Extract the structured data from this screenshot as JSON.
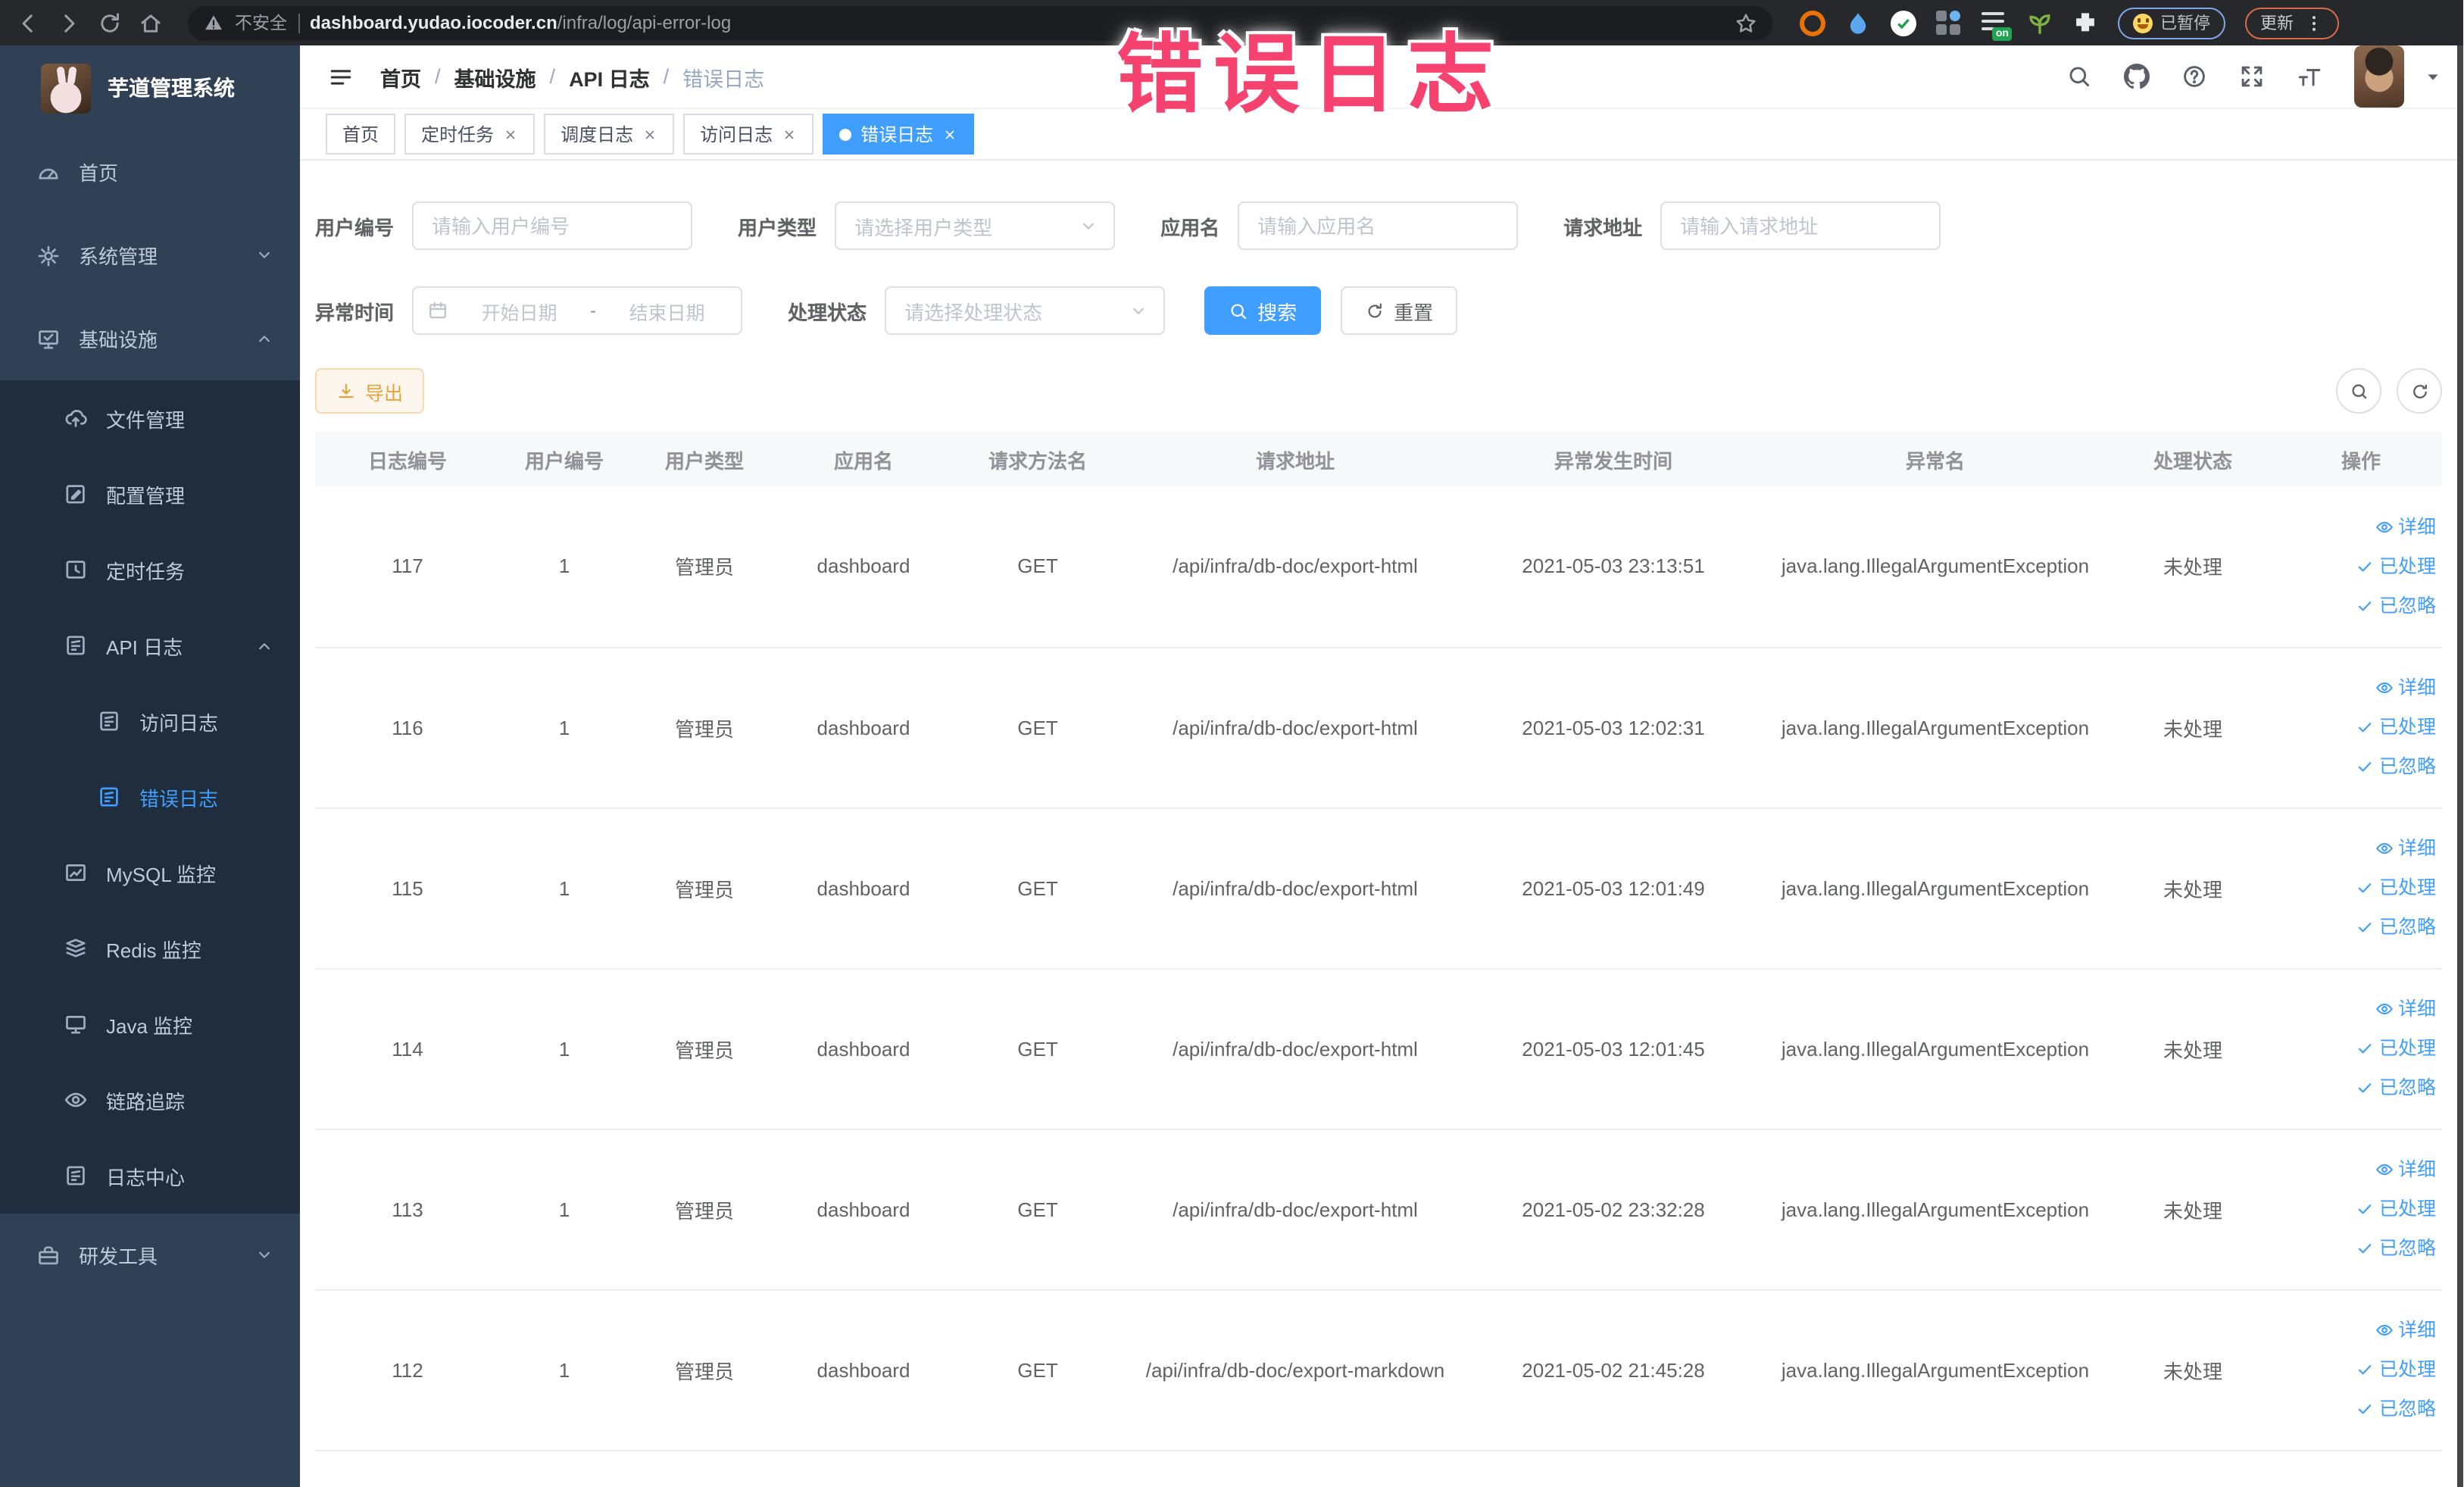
{
  "browser": {
    "security_label": "不安全",
    "url_host": "dashboard.yudao.iocoder.cn",
    "url_path": "/infra/log/api-error-log",
    "paused_label": "已暂停",
    "update_label": "更新",
    "on_badge": "on"
  },
  "annotation": {
    "text": "错误日志",
    "color": "#f5426f"
  },
  "sidebar": {
    "title": "芋道管理系统",
    "menu": [
      {
        "name": "home",
        "label": "首页",
        "icon": "dashboard-icon",
        "level": 1,
        "sub": false,
        "chevron": "",
        "active": false
      },
      {
        "name": "system",
        "label": "系统管理",
        "icon": "gear-icon",
        "level": 1,
        "sub": false,
        "chevron": "down",
        "active": false
      },
      {
        "name": "infra",
        "label": "基础设施",
        "icon": "monitor-check-icon",
        "level": 1,
        "sub": false,
        "chevron": "up",
        "active": false
      },
      {
        "name": "file",
        "label": "文件管理",
        "icon": "cloud-upload-icon",
        "level": 2,
        "sub": true,
        "chevron": "",
        "active": false
      },
      {
        "name": "config",
        "label": "配置管理",
        "icon": "edit-square-icon",
        "level": 2,
        "sub": true,
        "chevron": "",
        "active": false
      },
      {
        "name": "job",
        "label": "定时任务",
        "icon": "history-icon",
        "level": 2,
        "sub": true,
        "chevron": "",
        "active": false
      },
      {
        "name": "api-log",
        "label": "API 日志",
        "icon": "doc-edit-icon",
        "level": 2,
        "sub": true,
        "chevron": "up",
        "active": false
      },
      {
        "name": "access-log",
        "label": "访问日志",
        "icon": "doc-edit-icon",
        "level": 3,
        "sub": true,
        "chevron": "",
        "active": false
      },
      {
        "name": "error-log",
        "label": "错误日志",
        "icon": "doc-edit-icon",
        "level": 3,
        "sub": true,
        "chevron": "",
        "active": true
      },
      {
        "name": "mysql",
        "label": "MySQL 监控",
        "icon": "chart-icon",
        "level": 2,
        "sub": true,
        "chevron": "",
        "active": false
      },
      {
        "name": "redis",
        "label": "Redis 监控",
        "icon": "stack-icon",
        "level": 2,
        "sub": true,
        "chevron": "",
        "active": false
      },
      {
        "name": "java",
        "label": "Java 监控",
        "icon": "screen-icon",
        "level": 2,
        "sub": true,
        "chevron": "",
        "active": false
      },
      {
        "name": "tracer",
        "label": "链路追踪",
        "icon": "eye-icon",
        "level": 2,
        "sub": true,
        "chevron": "",
        "active": false
      },
      {
        "name": "log-center",
        "label": "日志中心",
        "icon": "doc-edit-icon",
        "level": 2,
        "sub": true,
        "chevron": "",
        "active": false
      },
      {
        "name": "dev-tools",
        "label": "研发工具",
        "icon": "toolbox-icon",
        "level": 1,
        "sub": false,
        "chevron": "down",
        "active": false
      }
    ]
  },
  "header": {
    "separator": "/",
    "breadcrumb": [
      {
        "label": "首页",
        "current": false
      },
      {
        "label": "基础设施",
        "current": false
      },
      {
        "label": "API 日志",
        "current": false
      },
      {
        "label": "错误日志",
        "current": true
      }
    ]
  },
  "tabs": [
    {
      "name": "home",
      "label": "首页",
      "closable": false,
      "active": false
    },
    {
      "name": "job",
      "label": "定时任务",
      "closable": true,
      "active": false
    },
    {
      "name": "job-log",
      "label": "调度日志",
      "closable": true,
      "active": false
    },
    {
      "name": "access-log",
      "label": "访问日志",
      "closable": true,
      "active": false
    },
    {
      "name": "error-log",
      "label": "错误日志",
      "closable": true,
      "active": true
    }
  ],
  "filters": {
    "user_id": {
      "label": "用户编号",
      "placeholder": "请输入用户编号"
    },
    "user_type": {
      "label": "用户类型",
      "placeholder": "请选择用户类型"
    },
    "app_name": {
      "label": "应用名",
      "placeholder": "请输入应用名"
    },
    "request_url": {
      "label": "请求地址",
      "placeholder": "请输入请求地址"
    },
    "exception_time": {
      "label": "异常时间",
      "start_placeholder": "开始日期",
      "separator": "-",
      "end_placeholder": "结束日期"
    },
    "process_status": {
      "label": "处理状态",
      "placeholder": "请选择处理状态"
    },
    "search_button": "搜索",
    "reset_button": "重置"
  },
  "toolbar": {
    "export_button": "导出"
  },
  "table": {
    "columns": [
      "日志编号",
      "用户编号",
      "用户类型",
      "应用名",
      "请求方法名",
      "请求地址",
      "异常发生时间",
      "异常名",
      "处理状态",
      "操作"
    ],
    "row_actions": [
      {
        "name": "detail",
        "label": "详细",
        "icon": "eye-icon"
      },
      {
        "name": "done",
        "label": "已处理",
        "icon": "check-icon"
      },
      {
        "name": "ignore",
        "label": "已忽略",
        "icon": "check-icon"
      }
    ],
    "rows": [
      {
        "id": "117",
        "user_id": "1",
        "user_type": "管理员",
        "app": "dashboard",
        "method": "GET",
        "url": "/api/infra/db-doc/export-html",
        "time": "2021-05-03 23:13:51",
        "exception": "java.lang.IllegalArgumentException",
        "status": "未处理"
      },
      {
        "id": "116",
        "user_id": "1",
        "user_type": "管理员",
        "app": "dashboard",
        "method": "GET",
        "url": "/api/infra/db-doc/export-html",
        "time": "2021-05-03 12:02:31",
        "exception": "java.lang.IllegalArgumentException",
        "status": "未处理"
      },
      {
        "id": "115",
        "user_id": "1",
        "user_type": "管理员",
        "app": "dashboard",
        "method": "GET",
        "url": "/api/infra/db-doc/export-html",
        "time": "2021-05-03 12:01:49",
        "exception": "java.lang.IllegalArgumentException",
        "status": "未处理"
      },
      {
        "id": "114",
        "user_id": "1",
        "user_type": "管理员",
        "app": "dashboard",
        "method": "GET",
        "url": "/api/infra/db-doc/export-html",
        "time": "2021-05-03 12:01:45",
        "exception": "java.lang.IllegalArgumentException",
        "status": "未处理"
      },
      {
        "id": "113",
        "user_id": "1",
        "user_type": "管理员",
        "app": "dashboard",
        "method": "GET",
        "url": "/api/infra/db-doc/export-html",
        "time": "2021-05-02 23:32:28",
        "exception": "java.lang.IllegalArgumentException",
        "status": "未处理"
      },
      {
        "id": "112",
        "user_id": "1",
        "user_type": "管理员",
        "app": "dashboard",
        "method": "GET",
        "url": "/api/infra/db-doc/export-markdown",
        "time": "2021-05-02 21:45:28",
        "exception": "java.lang.IllegalArgumentException",
        "status": "未处理"
      }
    ]
  },
  "colors": {
    "accent": "#409eff",
    "warning": "#e6a23c",
    "sidebar_bg": "#304156",
    "submenu_bg": "#1f2d3d",
    "annotation": "#f5426f"
  }
}
